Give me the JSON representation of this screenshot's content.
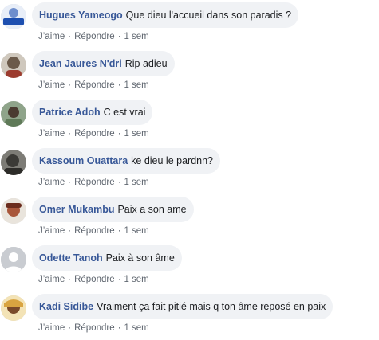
{
  "actions": {
    "like": "J’aime",
    "reply": "Répondre",
    "separator": "·"
  },
  "comments": [
    {
      "author": "Hugues Yameogo",
      "text": "Que dieu l'accueil dans son paradis ?",
      "time": "1 sem",
      "avatar_color": "#1d4fb0"
    },
    {
      "author": "Jean Jaures N'dri",
      "text": "Rip adieu",
      "time": "1 sem",
      "avatar_color": "#6b5a4a"
    },
    {
      "author": "Patrice Adoh",
      "text": "C est vrai",
      "time": "1 sem",
      "avatar_color": "#5f7a58"
    },
    {
      "author": "Kassoum Ouattara",
      "text": "ke dieu le pardnn?",
      "time": "1 sem",
      "avatar_color": "#3b3a36"
    },
    {
      "author": "Omer Mukambu",
      "text": "Paix a son ame",
      "time": "1 sem",
      "avatar_color": "#a8563a"
    },
    {
      "author": "Odette Tanoh",
      "text": "Paix à son âme",
      "time": "1 sem",
      "avatar_color": "#c9ccd1"
    },
    {
      "author": "Kadi Sidibe",
      "text": "Vraiment ça fait pitié mais q ton âme reposé en paix",
      "time": "1 sem",
      "avatar_color": "#d9a441"
    }
  ]
}
